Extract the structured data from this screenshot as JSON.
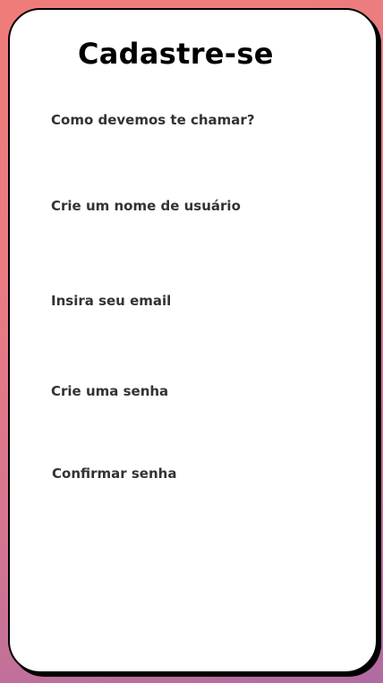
{
  "title": "Cadastre-se",
  "colors": {
    "background_start": "#f07c7a",
    "background_end": "#b06ba3",
    "card": "#ffffff",
    "border": "#000000",
    "label": "#333333"
  },
  "fields": [
    {
      "label": "Como devemos te chamar?",
      "value": ""
    },
    {
      "label": "Crie um nome de usuário",
      "value": ""
    },
    {
      "label": "Insira seu email",
      "value": ""
    },
    {
      "label": "Crie uma senha",
      "value": ""
    },
    {
      "label": "Confirmar senha",
      "value": ""
    }
  ]
}
